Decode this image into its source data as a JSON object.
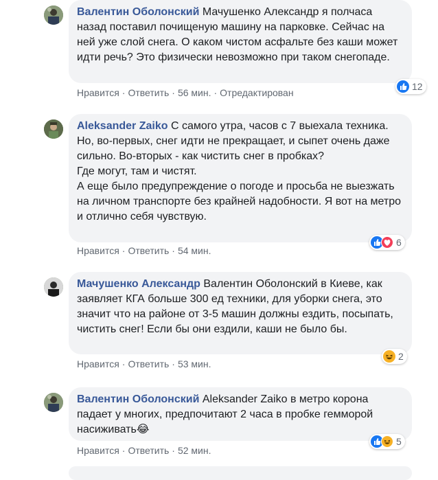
{
  "comments": [
    {
      "author": "Валентин Оболонский",
      "text": "Мачушенко Александр я полчаса назад поставил почищеную машину на парковке. Сейчас на ней уже слой снега. О каком чистом асфальте без каши может идти речь? Это физически невозможно при таком снегопаде.",
      "like": "Нравится",
      "reply": "Ответить",
      "time": "56 мин.",
      "edited": "Отредактирован",
      "reaction_count": "12",
      "reactions": [
        "like-icon"
      ]
    },
    {
      "author": "Aleksander Zaiko",
      "text": "С самого утра, часов с 7 выехала техника. Но, во-первых, снег идти не прекращает, и сыпет очень даже сильно. Во-вторых - как чистить снег в пробках?\nГде могут, там и чистят.\nА еще было предупреждение о погоде и просьба не выезжать на личном транспорте без крайней надобности. Я вот на метро и отлично себя чувствую.",
      "like": "Нравится",
      "reply": "Ответить",
      "time": "54 мин.",
      "reaction_count": "6",
      "reactions": [
        "like-icon",
        "love-icon"
      ]
    },
    {
      "author": "Мачушенко Александр",
      "text": "Валентин Оболонский в Киеве, как заявляет КГА больше 300 ед техники, для уборки снега, это значит что на районе от 3-5 машин должны ездить, посыпать, чистить снег! Если бы они ездили, каши не было бы.",
      "like": "Нравится",
      "reply": "Ответить",
      "time": "53 мин.",
      "reaction_count": "2",
      "reactions": [
        "haha-icon"
      ]
    },
    {
      "author": "Валентин Оболонский",
      "text": "Aleksander Zaiko в метро корона падает у многих, предпочитают 2 часа в пробке гемморой насиживать",
      "emoji": "😂",
      "like": "Нравится",
      "reply": "Ответить",
      "time": "52 мин.",
      "reaction_count": "5",
      "reactions": [
        "like-icon",
        "haha-icon"
      ]
    }
  ],
  "colors": {
    "author": "#385898",
    "bubble": "#f2f3f5",
    "meta": "#606770",
    "like": "#1877f2",
    "love": "#f33e58",
    "haha": "#f7b125"
  }
}
